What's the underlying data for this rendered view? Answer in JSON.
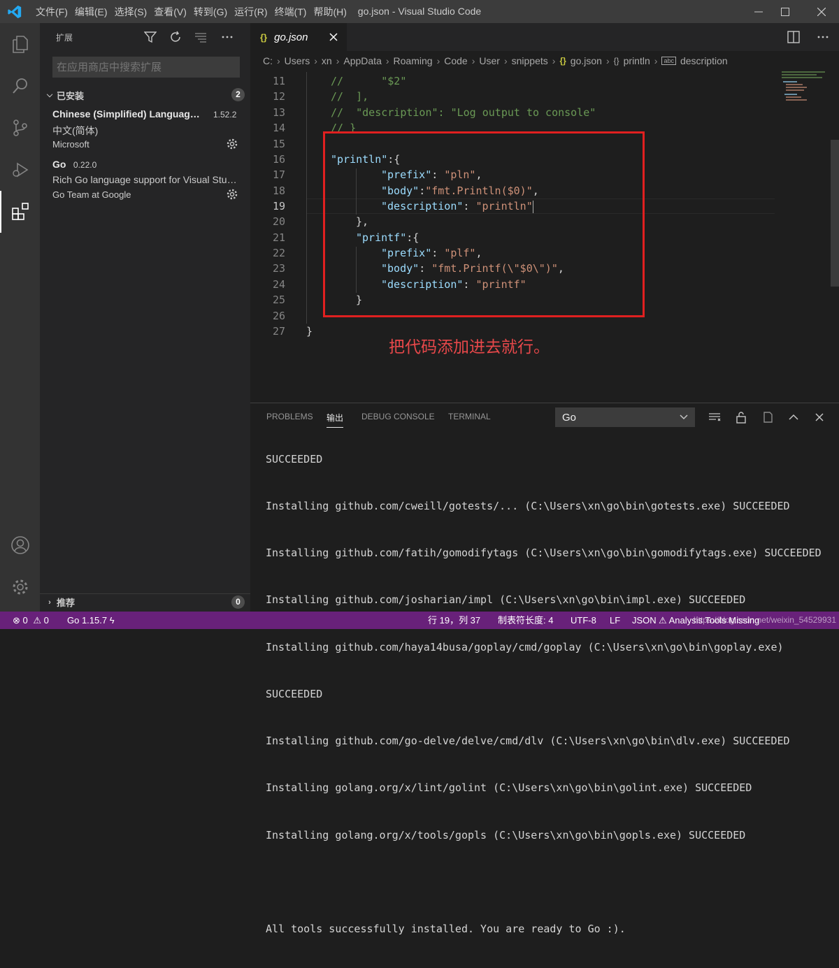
{
  "titlebar": {
    "menu": [
      "文件(F)",
      "编辑(E)",
      "选择(S)",
      "查看(V)",
      "转到(G)",
      "运行(R)",
      "终端(T)",
      "帮助(H)"
    ],
    "title": "go.json - Visual Studio Code"
  },
  "sidebar": {
    "title": "扩展",
    "search_placeholder": "在应用商店中搜索扩展",
    "installed_label": "已安装",
    "installed_count": "2",
    "extensions": [
      {
        "name": "Chinese (Simplified) Language Pack for Visual Studio Code",
        "version": "1.52.2",
        "description": "中文(简体)",
        "publisher": "Microsoft"
      },
      {
        "name": "Go",
        "version": "0.22.0",
        "description": "Rich Go language support for Visual Studio Code",
        "publisher": "Go Team at Google"
      }
    ],
    "recommended_label": "推荐",
    "recommended_count": "0"
  },
  "editor": {
    "tab_label": "go.json",
    "breadcrumb": [
      "C:",
      "Users",
      "xn",
      "AppData",
      "Roaming",
      "Code",
      "User",
      "snippets",
      "go.json",
      "println",
      "description"
    ],
    "lines": [
      {
        "n": "11",
        "text": "//      \"$2\""
      },
      {
        "n": "12",
        "text": "//  ],"
      },
      {
        "n": "13",
        "text": "//  \"description\": \"Log output to console\""
      },
      {
        "n": "14",
        "text": "// }"
      },
      {
        "n": "15",
        "text": ""
      },
      {
        "n": "16",
        "key": "\"println\"",
        "rest": ":{"
      },
      {
        "n": "17",
        "key": "\"prefix\"",
        "punc": ": ",
        "val": "\"pln\"",
        "tail": ","
      },
      {
        "n": "18",
        "key": "\"body\"",
        "punc": ":",
        "val": "\"fmt.Println($0)\"",
        "tail": ","
      },
      {
        "n": "19",
        "key": "\"description\"",
        "punc": ": ",
        "val": "\"println\"",
        "tail": ""
      },
      {
        "n": "20",
        "text": "},"
      },
      {
        "n": "21",
        "key": "\"printf\"",
        "rest": ":{"
      },
      {
        "n": "22",
        "key": "\"prefix\"",
        "punc": ": ",
        "val": "\"plf\"",
        "tail": ","
      },
      {
        "n": "23",
        "key": "\"body\"",
        "punc": ": ",
        "val": "\"fmt.Printf(\\\"$0\\\")\"",
        "tail": ","
      },
      {
        "n": "24",
        "key": "\"description\"",
        "punc": ": ",
        "val": "\"printf\"",
        "tail": ""
      },
      {
        "n": "25",
        "text": "}"
      },
      {
        "n": "26",
        "text": ""
      },
      {
        "n": "27",
        "text": "}"
      }
    ],
    "annotation": "把代码添加进去就行。"
  },
  "panel": {
    "tabs": [
      "PROBLEMS",
      "输出",
      "DEBUG CONSOLE",
      "TERMINAL"
    ],
    "channel": "Go",
    "output_lines": [
      "SUCCEEDED",
      "Installing github.com/cweill/gotests/... (C:\\Users\\xn\\go\\bin\\gotests.exe) SUCCEEDED",
      "Installing github.com/fatih/gomodifytags (C:\\Users\\xn\\go\\bin\\gomodifytags.exe) SUCCEEDED",
      "Installing github.com/josharian/impl (C:\\Users\\xn\\go\\bin\\impl.exe) SUCCEEDED",
      "Installing github.com/haya14busa/goplay/cmd/goplay (C:\\Users\\xn\\go\\bin\\goplay.exe)",
      "SUCCEEDED",
      "Installing github.com/go-delve/delve/cmd/dlv (C:\\Users\\xn\\go\\bin\\dlv.exe) SUCCEEDED",
      "Installing golang.org/x/lint/golint (C:\\Users\\xn\\go\\bin\\golint.exe) SUCCEEDED",
      "Installing golang.org/x/tools/gopls (C:\\Users\\xn\\go\\bin\\gopls.exe) SUCCEEDED",
      "",
      "All tools successfully installed. You are ready to Go :)."
    ]
  },
  "statusbar": {
    "errors": "0",
    "warnings": "0",
    "go_version": "Go 1.15.7",
    "position": "行 19，列 37",
    "tab_size": "制表符长度: 4",
    "encoding": "UTF-8",
    "eol": "LF",
    "language": "JSON",
    "analysis": "Analysis Tools Missing",
    "watermark": "https://blog.csdn.net/weixin_54529931"
  },
  "colors": {
    "statusbar": "#68217a",
    "accent": "#007acc",
    "annotation": "#e02020"
  }
}
